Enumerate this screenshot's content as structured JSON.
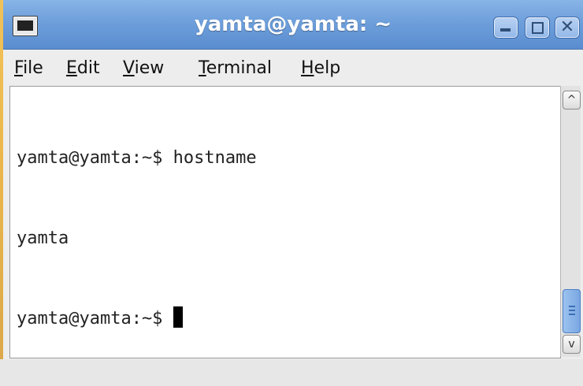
{
  "window": {
    "title": "yamta@yamta: ~",
    "controls": [
      "minimize",
      "maximize",
      "close"
    ],
    "close_glyph": "✕"
  },
  "menu": [
    {
      "label": "File",
      "mnemonic": "F",
      "rest": "ile"
    },
    {
      "label": "Edit",
      "mnemonic": "E",
      "rest": "dit"
    },
    {
      "label": "View",
      "mnemonic": "V",
      "rest": "iew"
    },
    {
      "label": "Terminal",
      "mnemonic": "T",
      "rest": "erminal"
    },
    {
      "label": "Help",
      "mnemonic": "H",
      "rest": "elp"
    }
  ],
  "terminal": {
    "lines": [
      "yamta@yamta:~$ hostname",
      "yamta",
      "yamta@yamta:~$ "
    ]
  },
  "scrollbar": {
    "up_glyph": "^",
    "down_glyph": "v"
  },
  "colors": {
    "titlebar": "#6e9fdb",
    "accent": "#5a8dd0",
    "terminal_bg": "#ffffff",
    "terminal_fg": "#222222"
  }
}
